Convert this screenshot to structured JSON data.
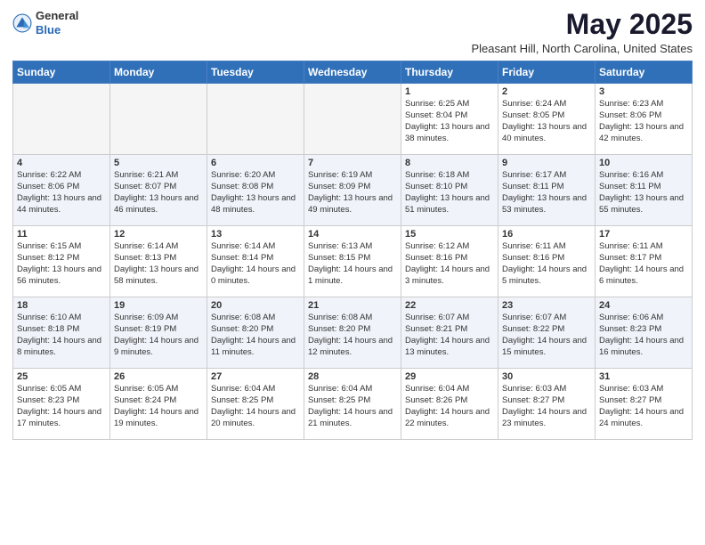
{
  "header": {
    "logo_general": "General",
    "logo_blue": "Blue",
    "month": "May 2025",
    "location": "Pleasant Hill, North Carolina, United States"
  },
  "weekdays": [
    "Sunday",
    "Monday",
    "Tuesday",
    "Wednesday",
    "Thursday",
    "Friday",
    "Saturday"
  ],
  "weeks": [
    [
      {
        "day": "",
        "detail": ""
      },
      {
        "day": "",
        "detail": ""
      },
      {
        "day": "",
        "detail": ""
      },
      {
        "day": "",
        "detail": ""
      },
      {
        "day": "1",
        "detail": "Sunrise: 6:25 AM\nSunset: 8:04 PM\nDaylight: 13 hours\nand 38 minutes."
      },
      {
        "day": "2",
        "detail": "Sunrise: 6:24 AM\nSunset: 8:05 PM\nDaylight: 13 hours\nand 40 minutes."
      },
      {
        "day": "3",
        "detail": "Sunrise: 6:23 AM\nSunset: 8:06 PM\nDaylight: 13 hours\nand 42 minutes."
      }
    ],
    [
      {
        "day": "4",
        "detail": "Sunrise: 6:22 AM\nSunset: 8:06 PM\nDaylight: 13 hours\nand 44 minutes."
      },
      {
        "day": "5",
        "detail": "Sunrise: 6:21 AM\nSunset: 8:07 PM\nDaylight: 13 hours\nand 46 minutes."
      },
      {
        "day": "6",
        "detail": "Sunrise: 6:20 AM\nSunset: 8:08 PM\nDaylight: 13 hours\nand 48 minutes."
      },
      {
        "day": "7",
        "detail": "Sunrise: 6:19 AM\nSunset: 8:09 PM\nDaylight: 13 hours\nand 49 minutes."
      },
      {
        "day": "8",
        "detail": "Sunrise: 6:18 AM\nSunset: 8:10 PM\nDaylight: 13 hours\nand 51 minutes."
      },
      {
        "day": "9",
        "detail": "Sunrise: 6:17 AM\nSunset: 8:11 PM\nDaylight: 13 hours\nand 53 minutes."
      },
      {
        "day": "10",
        "detail": "Sunrise: 6:16 AM\nSunset: 8:11 PM\nDaylight: 13 hours\nand 55 minutes."
      }
    ],
    [
      {
        "day": "11",
        "detail": "Sunrise: 6:15 AM\nSunset: 8:12 PM\nDaylight: 13 hours\nand 56 minutes."
      },
      {
        "day": "12",
        "detail": "Sunrise: 6:14 AM\nSunset: 8:13 PM\nDaylight: 13 hours\nand 58 minutes."
      },
      {
        "day": "13",
        "detail": "Sunrise: 6:14 AM\nSunset: 8:14 PM\nDaylight: 14 hours\nand 0 minutes."
      },
      {
        "day": "14",
        "detail": "Sunrise: 6:13 AM\nSunset: 8:15 PM\nDaylight: 14 hours\nand 1 minute."
      },
      {
        "day": "15",
        "detail": "Sunrise: 6:12 AM\nSunset: 8:16 PM\nDaylight: 14 hours\nand 3 minutes."
      },
      {
        "day": "16",
        "detail": "Sunrise: 6:11 AM\nSunset: 8:16 PM\nDaylight: 14 hours\nand 5 minutes."
      },
      {
        "day": "17",
        "detail": "Sunrise: 6:11 AM\nSunset: 8:17 PM\nDaylight: 14 hours\nand 6 minutes."
      }
    ],
    [
      {
        "day": "18",
        "detail": "Sunrise: 6:10 AM\nSunset: 8:18 PM\nDaylight: 14 hours\nand 8 minutes."
      },
      {
        "day": "19",
        "detail": "Sunrise: 6:09 AM\nSunset: 8:19 PM\nDaylight: 14 hours\nand 9 minutes."
      },
      {
        "day": "20",
        "detail": "Sunrise: 6:08 AM\nSunset: 8:20 PM\nDaylight: 14 hours\nand 11 minutes."
      },
      {
        "day": "21",
        "detail": "Sunrise: 6:08 AM\nSunset: 8:20 PM\nDaylight: 14 hours\nand 12 minutes."
      },
      {
        "day": "22",
        "detail": "Sunrise: 6:07 AM\nSunset: 8:21 PM\nDaylight: 14 hours\nand 13 minutes."
      },
      {
        "day": "23",
        "detail": "Sunrise: 6:07 AM\nSunset: 8:22 PM\nDaylight: 14 hours\nand 15 minutes."
      },
      {
        "day": "24",
        "detail": "Sunrise: 6:06 AM\nSunset: 8:23 PM\nDaylight: 14 hours\nand 16 minutes."
      }
    ],
    [
      {
        "day": "25",
        "detail": "Sunrise: 6:05 AM\nSunset: 8:23 PM\nDaylight: 14 hours\nand 17 minutes."
      },
      {
        "day": "26",
        "detail": "Sunrise: 6:05 AM\nSunset: 8:24 PM\nDaylight: 14 hours\nand 19 minutes."
      },
      {
        "day": "27",
        "detail": "Sunrise: 6:04 AM\nSunset: 8:25 PM\nDaylight: 14 hours\nand 20 minutes."
      },
      {
        "day": "28",
        "detail": "Sunrise: 6:04 AM\nSunset: 8:25 PM\nDaylight: 14 hours\nand 21 minutes."
      },
      {
        "day": "29",
        "detail": "Sunrise: 6:04 AM\nSunset: 8:26 PM\nDaylight: 14 hours\nand 22 minutes."
      },
      {
        "day": "30",
        "detail": "Sunrise: 6:03 AM\nSunset: 8:27 PM\nDaylight: 14 hours\nand 23 minutes."
      },
      {
        "day": "31",
        "detail": "Sunrise: 6:03 AM\nSunset: 8:27 PM\nDaylight: 14 hours\nand 24 minutes."
      }
    ]
  ]
}
